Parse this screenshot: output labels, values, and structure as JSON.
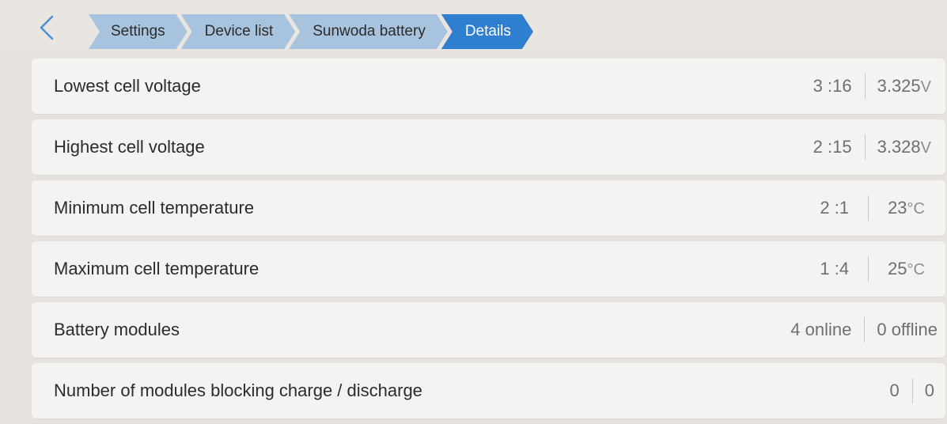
{
  "breadcrumb": {
    "items": [
      {
        "label": "Settings",
        "active": false
      },
      {
        "label": "Device list",
        "active": false
      },
      {
        "label": "Sunwoda battery",
        "active": false
      },
      {
        "label": "Details",
        "active": true
      }
    ]
  },
  "rows": [
    {
      "label": "Lowest cell voltage",
      "left": "3 :16",
      "right_value": "3.325",
      "right_unit": "V"
    },
    {
      "label": "Highest cell voltage",
      "left": "2 :15",
      "right_value": "3.328",
      "right_unit": "V"
    },
    {
      "label": "Minimum cell temperature",
      "left": "2 :1",
      "right_value": "23",
      "right_unit": "°C"
    },
    {
      "label": "Maximum cell temperature",
      "left": "1 :4",
      "right_value": "25",
      "right_unit": "°C"
    },
    {
      "label": "Battery modules",
      "left": "4 online",
      "right_value": "0 offline",
      "right_unit": ""
    },
    {
      "label": "Number of modules blocking charge / discharge",
      "left": "0",
      "right_value": "0",
      "right_unit": ""
    }
  ],
  "colors": {
    "crumb_inactive": "#a7c3dd",
    "crumb_active": "#2f7fd0",
    "back_arrow": "#4a90d9"
  }
}
